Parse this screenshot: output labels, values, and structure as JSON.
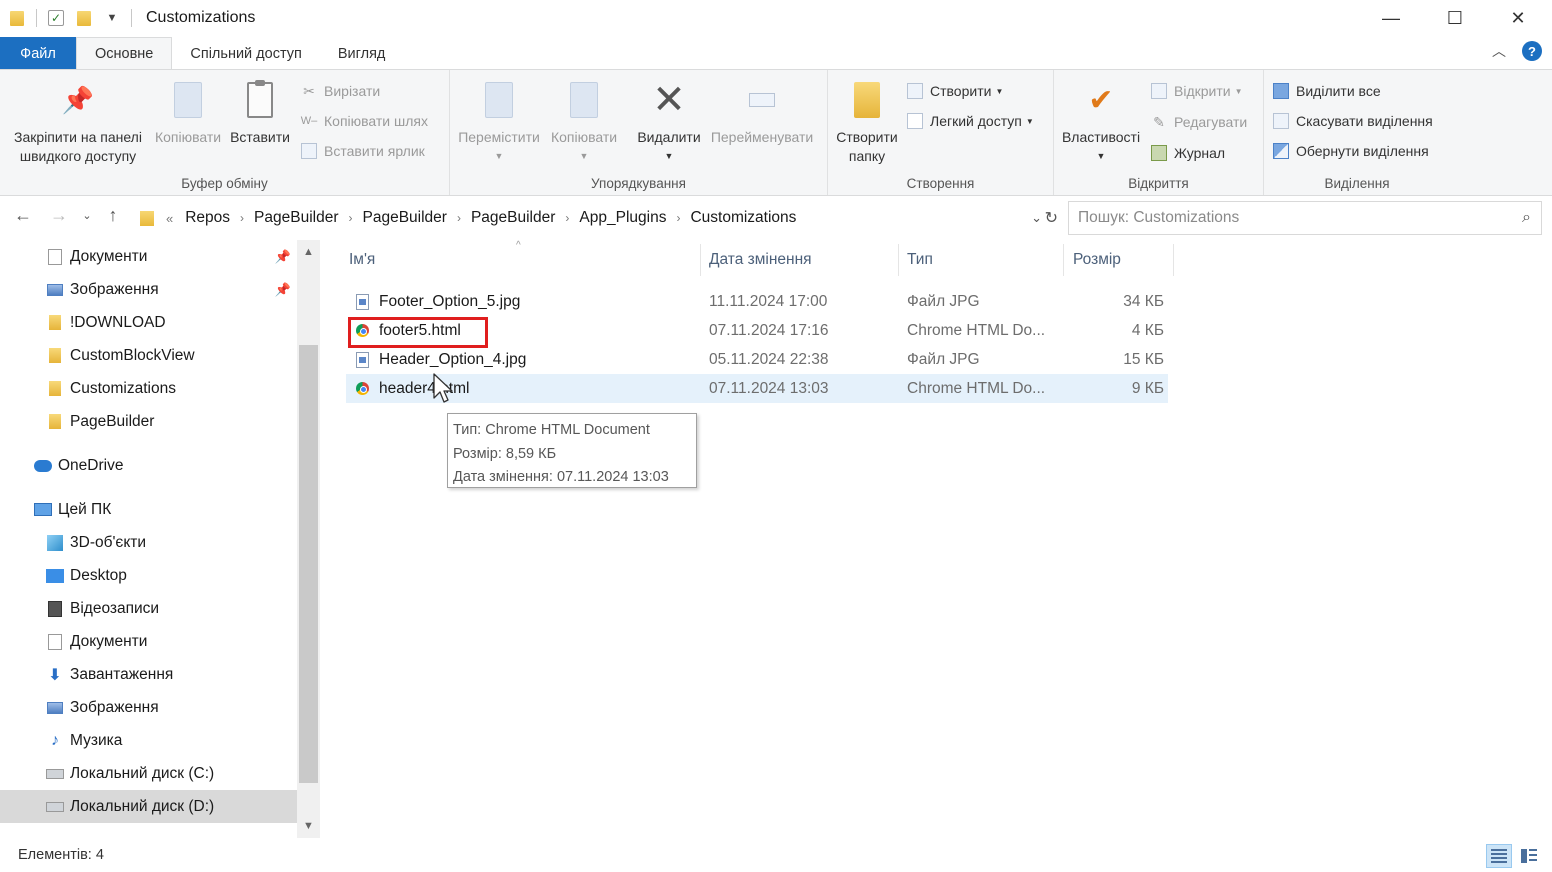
{
  "window": {
    "title": "Customizations",
    "minimize_glyph": "—",
    "maximize_glyph": "☐",
    "close_glyph": "✕"
  },
  "ribbon_tabs": [
    {
      "label": "Файл"
    },
    {
      "label": "Основне"
    },
    {
      "label": "Спільний доступ"
    },
    {
      "label": "Вигляд"
    }
  ],
  "ribbon": {
    "clipboard": {
      "label": "Буфер обміну",
      "pin": "Закріпити на панелі швидкого доступу",
      "copy": "Копіювати",
      "paste": "Вставити",
      "cut": "Вирізати",
      "copy_path": "Копіювати шлях",
      "paste_shortcut": "Вставити ярлик"
    },
    "organize": {
      "label": "Упорядкування",
      "move": "Перемістити",
      "copy": "Копіювати",
      "delete": "Видалити",
      "rename": "Перейменувати"
    },
    "new": {
      "label": "Створення",
      "new_folder": "Створити папку",
      "new_item": "Створити",
      "easy_access": "Легкий доступ"
    },
    "open": {
      "label": "Відкриття",
      "properties": "Властивості",
      "open": "Відкрити",
      "edit": "Редагувати",
      "history": "Журнал"
    },
    "select": {
      "label": "Виділення",
      "select_all": "Виділити все",
      "select_none": "Скасувати виділення",
      "invert": "Обернути виділення"
    }
  },
  "address": {
    "overflow": "«",
    "crumbs": [
      "Repos",
      "PageBuilder",
      "PageBuilder",
      "PageBuilder",
      "App_Plugins",
      "Customizations"
    ],
    "search_placeholder": "Пошук: Customizations"
  },
  "sidebar": {
    "items": [
      {
        "label": "Документи",
        "icon": "documents-icon",
        "pinned": true
      },
      {
        "label": "Зображення",
        "icon": "pictures-icon",
        "pinned": true
      },
      {
        "label": "!DOWNLOAD",
        "icon": "folder-icon"
      },
      {
        "label": "CustomBlockView",
        "icon": "folder-icon"
      },
      {
        "label": "Customizations",
        "icon": "folder-icon"
      },
      {
        "label": "PageBuilder",
        "icon": "folder-icon"
      },
      {
        "label": "OneDrive",
        "icon": "cloud-icon"
      },
      {
        "label": "Цей ПК",
        "icon": "computer-icon"
      },
      {
        "label": "3D-об'єкти",
        "icon": "3d-objects-icon"
      },
      {
        "label": "Desktop",
        "icon": "desktop-icon"
      },
      {
        "label": "Відеозаписи",
        "icon": "videos-icon"
      },
      {
        "label": "Документи",
        "icon": "documents-icon"
      },
      {
        "label": "Завантаження",
        "icon": "downloads-icon"
      },
      {
        "label": "Зображення",
        "icon": "pictures-icon"
      },
      {
        "label": "Музика",
        "icon": "music-icon"
      },
      {
        "label": "Локальний диск (C:)",
        "icon": "drive-icon"
      },
      {
        "label": "Локальний диск (D:)",
        "icon": "drive-icon",
        "selected": true
      }
    ]
  },
  "columns": {
    "name": "Ім'я",
    "date": "Дата змінення",
    "type": "Тип",
    "size": "Розмір"
  },
  "files": [
    {
      "name": "Footer_Option_5.jpg",
      "date": "11.11.2024 17:00",
      "type": "Файл JPG",
      "size": "34 КБ",
      "icon": "jpg-file-icon"
    },
    {
      "name": "footer5.html",
      "date": "07.11.2024 17:16",
      "type": "Chrome HTML Do...",
      "size": "4 КБ",
      "icon": "chrome-html-icon",
      "highlighted": true
    },
    {
      "name": "Header_Option_4.jpg",
      "date": "05.11.2024 22:38",
      "type": "Файл JPG",
      "size": "15 КБ",
      "icon": "jpg-file-icon"
    },
    {
      "name": "header4.html",
      "date": "07.11.2024 13:03",
      "type": "Chrome HTML Do...",
      "size": "9 КБ",
      "icon": "chrome-html-icon",
      "hovered": true
    }
  ],
  "tooltip": {
    "line1": "Тип: Chrome HTML Document",
    "line2": "Розмір: 8,59 КБ",
    "line3": "Дата змінення: 07.11.2024 13:03"
  },
  "status": {
    "items": "Елементів: 4"
  },
  "colors": {
    "file_tab": "#1c6fc1",
    "highlight_box": "#e01e1e",
    "hover_row": "#e5f1fb",
    "column_header": "#4c607a"
  }
}
